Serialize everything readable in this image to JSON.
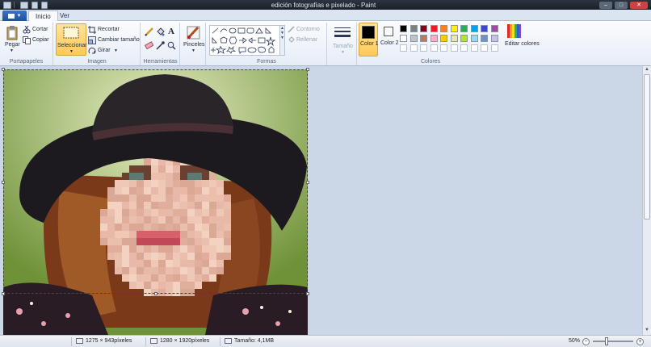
{
  "titlebar": {
    "title": "edición fotografías e pixelado - Paint"
  },
  "tabs": [
    {
      "label": "Inicio",
      "active": true
    },
    {
      "label": "Ver",
      "active": false
    }
  ],
  "ribbon": {
    "clipboard": {
      "paste": "Pegar",
      "cut": "Cortar",
      "copy": "Copiar",
      "group": "Portapapeles"
    },
    "image": {
      "select": "Seleccionar",
      "crop": "Recortar",
      "resize": "Cambiar tamaño",
      "rotate": "Girar",
      "group": "Imagen"
    },
    "tools": {
      "group": "Herramientas"
    },
    "brushes": {
      "label": "Pinceles"
    },
    "shapes": {
      "outline": "Contorno",
      "fill": "Rellenar",
      "group": "Formas"
    },
    "size": {
      "label": "Tamaño"
    },
    "colors": {
      "color1": "Color 1",
      "color2": "Color 2",
      "edit": "Editar colores",
      "group": "Colores",
      "color1_value": "#000000",
      "color2_value": "#ffffff",
      "palette": [
        "#000000",
        "#7f7f7f",
        "#880015",
        "#ed1c24",
        "#ff7f27",
        "#fff200",
        "#22b14c",
        "#00a2e8",
        "#3f48cc",
        "#a349a4",
        "#ffffff",
        "#c3c3c3",
        "#b97a57",
        "#ffaec9",
        "#ffc90e",
        "#efe4b0",
        "#b5e61d",
        "#99d9ea",
        "#7092be",
        "#c8bfe7",
        "#ffffff",
        "#ffffff",
        "#ffffff",
        "#ffffff",
        "#ffffff",
        "#ffffff",
        "#ffffff",
        "#ffffff",
        "#ffffff",
        "#ffffff"
      ]
    }
  },
  "statusbar": {
    "selection_size": "1275 × 943píxeles",
    "image_size": "1280 × 1920píxeles",
    "file_size": "Tamaño: 4,1MB",
    "zoom": "50%"
  }
}
